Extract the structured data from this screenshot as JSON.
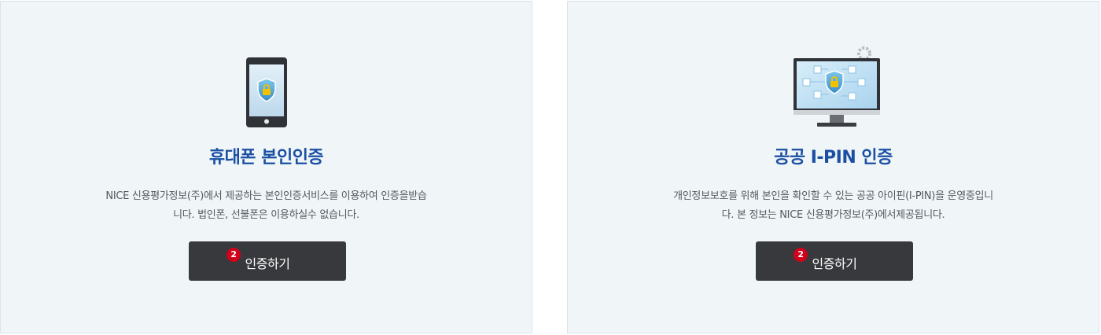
{
  "cards": [
    {
      "title": "휴대폰 본인인증",
      "desc_line1": "NICE 신용평가정보(주)에서 제공하는 본인인증서비스를 이용하여 인증을받습",
      "desc_line2": "니다. 법인폰, 선불폰은 이용하실수 없습니다.",
      "button_label": "인증하기",
      "badge": "2",
      "icon": "smartphone-shield-icon"
    },
    {
      "title": "공공 I-PIN 인증",
      "desc_line1": "개인정보보호를 위해 본인을 확인할 수 있는 공공 아이핀(I-PIN)을 운영중입니",
      "desc_line2": "다. 본 정보는 NICE 신용평가정보(주)에서제공됩니다.",
      "button_label": "인증하기",
      "badge": "2",
      "icon": "monitor-shield-icon"
    }
  ],
  "colors": {
    "title": "#1a4fa3",
    "button_bg": "#37393c",
    "badge_bg": "#d0021b",
    "card_bg": "#f0f5f8"
  }
}
